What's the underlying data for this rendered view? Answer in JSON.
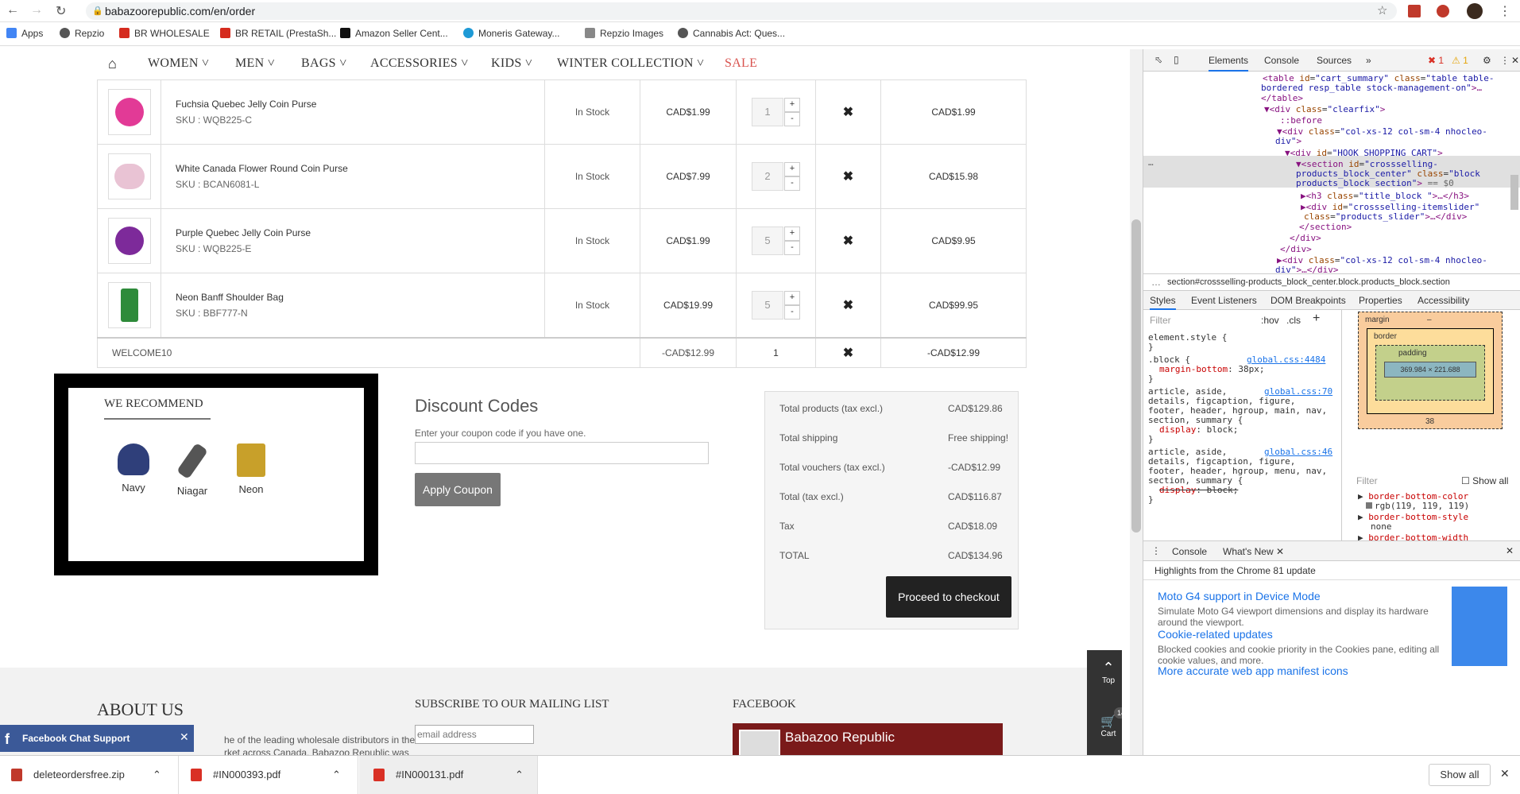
{
  "browser": {
    "url": "babazoorepublic.com/en/order",
    "bookmarks": [
      "Apps",
      "Repzio",
      "BR WHOLESALE",
      "BR RETAIL (PrestaSh...",
      "Amazon Seller Cent...",
      "Moneris Gateway...",
      "Repzio Images",
      "Cannabis Act: Ques..."
    ],
    "devtools_errors": "1",
    "devtools_warnings": "1"
  },
  "nav": {
    "items": [
      "WOMEN",
      "MEN",
      "BAGS",
      "ACCESSORIES",
      "KIDS",
      "WINTER COLLECTION"
    ],
    "sale": "SALE"
  },
  "cart": {
    "rows": [
      {
        "name": "Fuchsia Quebec Jelly Coin Purse",
        "sku": "SKU : WQB225-C",
        "availability": "In Stock",
        "unit_price": "CAD$1.99",
        "qty": "1",
        "total": "CAD$1.99",
        "thumb_color": "#e23a96"
      },
      {
        "name": "White Canada Flower Round Coin Purse",
        "sku": "SKU : BCAN6081-L",
        "availability": "In Stock",
        "unit_price": "CAD$7.99",
        "qty": "2",
        "total": "CAD$15.98",
        "thumb_color": "#e9c3d4"
      },
      {
        "name": "Purple Quebec Jelly Coin Purse",
        "sku": "SKU : WQB225-E",
        "availability": "In Stock",
        "unit_price": "CAD$1.99",
        "qty": "5",
        "total": "CAD$9.95",
        "thumb_color": "#7d2a9a"
      },
      {
        "name": "Neon Banff Shoulder Bag",
        "sku": "SKU : BBF777-N",
        "availability": "In Stock",
        "unit_price": "CAD$19.99",
        "qty": "5",
        "total": "CAD$99.95",
        "thumb_color": "#2e8b3a"
      }
    ],
    "voucher": {
      "code": "WELCOME10",
      "amount": "-CAD$12.99",
      "qty": "1",
      "total": "-CAD$12.99"
    }
  },
  "recommend": {
    "title": "WE RECOMMEND",
    "items": [
      {
        "label": "Navy",
        "color": "#2f3f7a"
      },
      {
        "label": "Niagar",
        "color": "#555555"
      },
      {
        "label": "Neon",
        "color": "#c8a02a"
      }
    ]
  },
  "discount": {
    "title": "Discount Codes",
    "hint": "Enter your coupon code if you have one.",
    "apply_label": "Apply Coupon"
  },
  "totals": {
    "rows": [
      {
        "label": "Total products (tax excl.)",
        "value": "CAD$129.86"
      },
      {
        "label": "Total shipping",
        "value": "Free shipping!"
      },
      {
        "label": "Total vouchers (tax excl.)",
        "value": "-CAD$12.99"
      },
      {
        "label": "Total (tax excl.)",
        "value": "CAD$116.87"
      },
      {
        "label": "Tax",
        "value": "CAD$18.09"
      },
      {
        "label": "TOTAL",
        "value": "CAD$134.96"
      }
    ],
    "checkout_label": "Proceed to checkout"
  },
  "footer": {
    "about": "ABOUT US",
    "about_text_1": "he of the leading wholesale distributors in the",
    "about_text_2": "rket across Canada. Babazoo Republic was",
    "mailing": "SUBSCRIBE TO OUR MAILING LIST",
    "email_placeholder": "email address",
    "facebook": "FACEBOOK",
    "fb_page": "Babazoo Republic",
    "top_label": "Top",
    "cart_label": "Cart",
    "cart_count": "14",
    "fb_chat": "Facebook Chat Support"
  },
  "downloads": [
    {
      "name": "deleteordersfree.zip",
      "color": "#c0392b"
    },
    {
      "name": "#IN000393.pdf",
      "color": "#d93025"
    },
    {
      "name": "#IN000131.pdf",
      "color": "#d93025"
    }
  ],
  "downloads_show_all": "Show all",
  "devtools": {
    "tabs": [
      "Elements",
      "Console",
      "Sources"
    ],
    "breadcrumb": "section#crossselling-products_block_center.block.products_block.section",
    "style_tabs": [
      "Styles",
      "Event Listeners",
      "DOM Breakpoints",
      "Properties",
      "Accessibility"
    ],
    "filter": "Filter",
    "hov": ":hov",
    "cls": ".cls",
    "boxmodel": {
      "margin": "margin",
      "border": "border",
      "padding": "padding",
      "content": "369.984 × 221.688",
      "margin_bottom": "38",
      "dash": "–"
    },
    "show_all": "Show all",
    "computed": [
      "border-bottom-color",
      "rgb(119, 119, 119)",
      "border-bottom-style",
      "none",
      "border-bottom-width"
    ],
    "drawer_tabs": [
      "Console",
      "What's New"
    ],
    "highlights": "Highlights from the Chrome 81 update",
    "news": [
      {
        "title": "Moto G4 support in Device Mode",
        "desc": "Simulate Moto G4 viewport dimensions and display its hardware around the viewport."
      },
      {
        "title": "Cookie-related updates",
        "desc": "Blocked cookies and cookie priority in the Cookies pane, editing all cookie values, and more."
      },
      {
        "title": "More accurate web app manifest icons",
        "desc": ""
      }
    ]
  }
}
